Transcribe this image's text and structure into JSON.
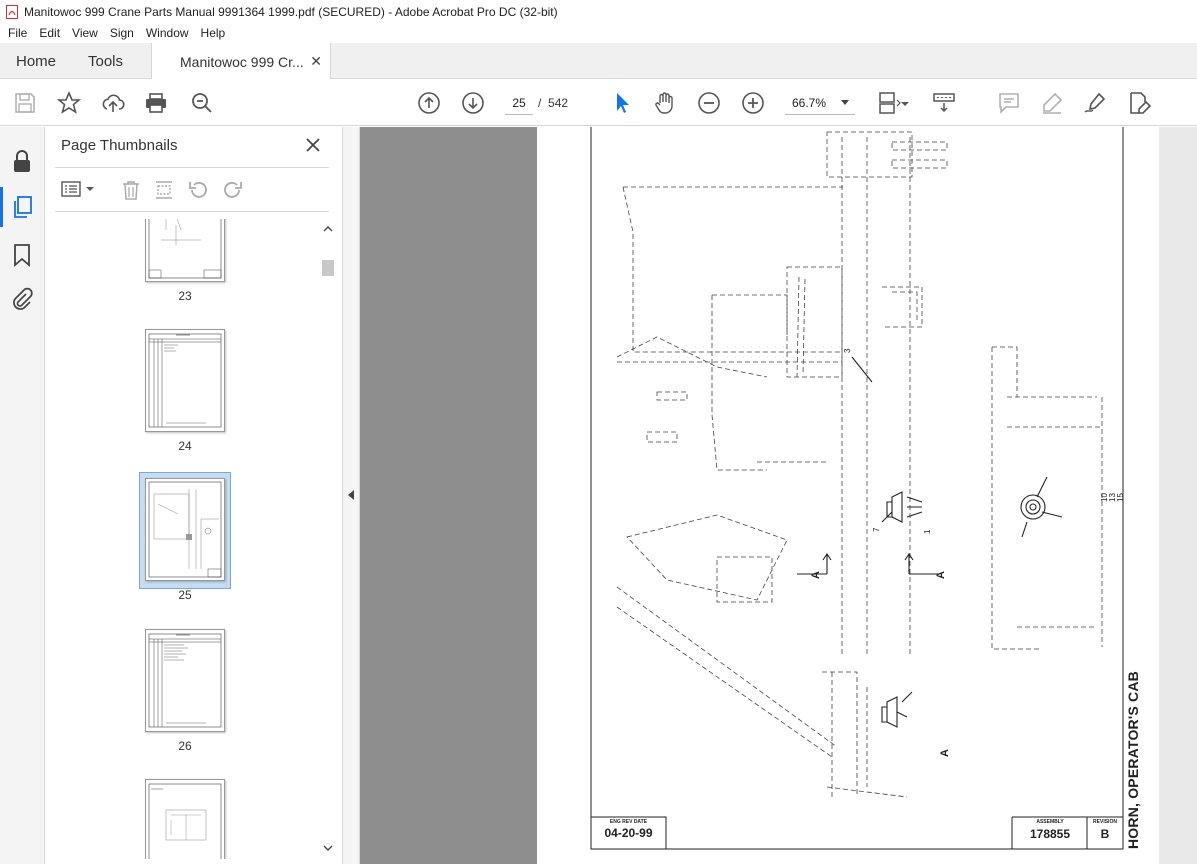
{
  "window": {
    "title": "Manitowoc 999 Crane Parts Manual 9991364 1999.pdf (SECURED) - Adobe Acrobat Pro DC (32-bit)"
  },
  "menu": [
    "File",
    "Edit",
    "View",
    "Sign",
    "Window",
    "Help"
  ],
  "tabs": {
    "home": "Home",
    "tools": "Tools",
    "document": "Manitowoc 999 Cr..."
  },
  "toolbar": {
    "current_page": "25",
    "page_separator": "/",
    "total_pages": "542",
    "zoom": "66.7%"
  },
  "panel": {
    "title": "Page Thumbnails",
    "thumbnails": [
      {
        "label": "23"
      },
      {
        "label": "24"
      },
      {
        "label": "25",
        "selected": true
      },
      {
        "label": "26"
      },
      {
        "label": ""
      }
    ]
  },
  "drawing": {
    "title": "HORN, OPERATOR'S CAB",
    "eng_rev_date_label": "ENG REV DATE",
    "eng_rev_date": "04-20-99",
    "assembly_label": "ASSEMBLY",
    "assembly": "178855",
    "revision_label": "REVISION",
    "revision": "B",
    "callouts": {
      "c3": "3",
      "c1015a": "10",
      "c1015b": "13",
      "c1015c": "15",
      "c7": "7",
      "c1": "1",
      "sectionA": "A"
    }
  }
}
